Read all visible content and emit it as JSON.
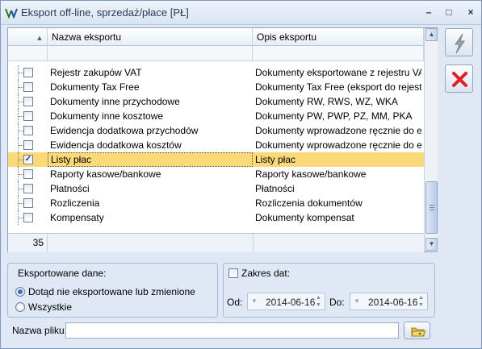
{
  "window": {
    "title": "Eksport off-line, sprzedaż/płace [PŁ]",
    "controls": {
      "minimize": "–",
      "maximize": "□",
      "close": "×"
    }
  },
  "grid": {
    "sort_indicator": "▲",
    "columns": [
      "Nazwa eksportu",
      "Opis eksportu"
    ],
    "rows": [
      {
        "name": "Rejestr zakupów VAT",
        "description": "Dokumenty eksportowane z rejestru VAT",
        "checked": false,
        "selected": false
      },
      {
        "name": "Dokumenty Tax Free",
        "description": "Dokumenty Tax Free (eksport do rejestr...",
        "checked": false,
        "selected": false
      },
      {
        "name": "Dokumenty inne przychodowe",
        "description": "Dokumenty RW, RWS, WZ, WKA",
        "checked": false,
        "selected": false
      },
      {
        "name": "Dokumenty inne kosztowe",
        "description": "Dokumenty PW, PWP, PZ, MM, PKA",
        "checked": false,
        "selected": false
      },
      {
        "name": "Ewidencja dodatkowa przychodów",
        "description": "Dokumenty wprowadzone ręcznie do ewi...",
        "checked": false,
        "selected": false
      },
      {
        "name": "Ewidencja dodatkowa kosztów",
        "description": "Dokumenty wprowadzone ręcznie do ewi...",
        "checked": false,
        "selected": false
      },
      {
        "name": "Listy płac",
        "description": "Listy płac",
        "checked": true,
        "selected": true
      },
      {
        "name": "Raporty kasowe/bankowe",
        "description": "Raporty kasowe/bankowe",
        "checked": false,
        "selected": false
      },
      {
        "name": "Płatności",
        "description": "Płatności",
        "checked": false,
        "selected": false
      },
      {
        "name": "Rozliczenia",
        "description": "Rozliczenia dokumentów",
        "checked": false,
        "selected": false
      },
      {
        "name": "Kompensaty",
        "description": "Dokumenty kompensat",
        "checked": false,
        "selected": false
      }
    ],
    "record_count": "35"
  },
  "exported_data": {
    "title": "Eksportowane dane:",
    "options": [
      "Dotąd nie eksportowane lub zmienione",
      "Wszystkie"
    ],
    "selected_index": 0
  },
  "date_range": {
    "label": "Zakres dat:",
    "checked": false,
    "from_label": "Od:",
    "from_value": "2014-06-16",
    "to_label": "Do:",
    "to_value": "2014-06-16"
  },
  "file": {
    "label": "Nazwa pliku:",
    "value": ""
  },
  "icons": {
    "app": "ve-icon",
    "execute": "lightning-icon",
    "close": "red-x-icon",
    "folder": "folder-icon"
  },
  "colors": {
    "selected_row": "#fbd979",
    "window_bg": "#dfe8f4",
    "close_red": "#e02020"
  }
}
